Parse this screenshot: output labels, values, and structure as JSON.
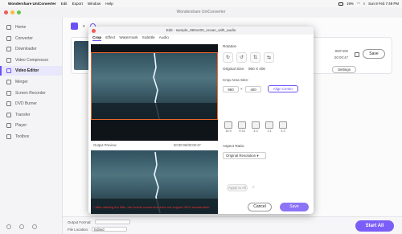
{
  "menubar": {
    "app": "Wondershare UniConverter",
    "items": [
      "Edit",
      "Export",
      "Window",
      "Help"
    ],
    "battery": "19%",
    "datetime": "Sun 8 Feb 7:49 PM"
  },
  "window": {
    "title": "Wondershare UniConverter"
  },
  "sidebar": {
    "items": [
      {
        "label": "Home"
      },
      {
        "label": "Converter"
      },
      {
        "label": "Downloader"
      },
      {
        "label": "Video Compressor"
      },
      {
        "label": "Video Editor"
      },
      {
        "label": "Merger"
      },
      {
        "label": "Screen Recorder"
      },
      {
        "label": "DVD Burner"
      },
      {
        "label": "Transfer"
      },
      {
        "label": "Player"
      },
      {
        "label": "Toolbox"
      }
    ]
  },
  "main": {
    "file": {
      "resolution": "800*400",
      "duration": "00:00:47",
      "save_label": "Save",
      "settings_label": "Settings"
    },
    "footer": {
      "output_format_label": "Output Format:",
      "file_location_label": "File Location:",
      "file_location_value": "Edited",
      "start_all_label": "Start All"
    }
  },
  "dialog": {
    "title": "Edit - sample_960x400_ocean_with_audio",
    "tabs": [
      "Crop",
      "Effect",
      "Watermark",
      "Subtitle",
      "Audio"
    ],
    "output_preview_label": "Output Preview",
    "time_display": "00:00:06/00:00:47",
    "rotation_label": "Rotation",
    "original_size_label": "Original Size:",
    "original_size_value": "960 X 400",
    "crop_area_label": "Crop Area Size:",
    "crop_width": "960",
    "crop_height": "400",
    "align_center_label": "Align Center",
    "ratios": [
      "16:9",
      "9:16",
      "4:3",
      "1:1",
      "4:3"
    ],
    "aspect_ratio_label": "Aspect Ratio:",
    "aspect_ratio_value": "Original Resolution",
    "apply_all_label": "Apply to All",
    "warning": "* After starting the filter, the format conversion does not support GPU acceleration.",
    "cancel_label": "Cancel",
    "save_label": "Save",
    "playback_progress": 0.28
  },
  "colors": {
    "accent": "#6b52f5",
    "warning": "#e33333"
  }
}
